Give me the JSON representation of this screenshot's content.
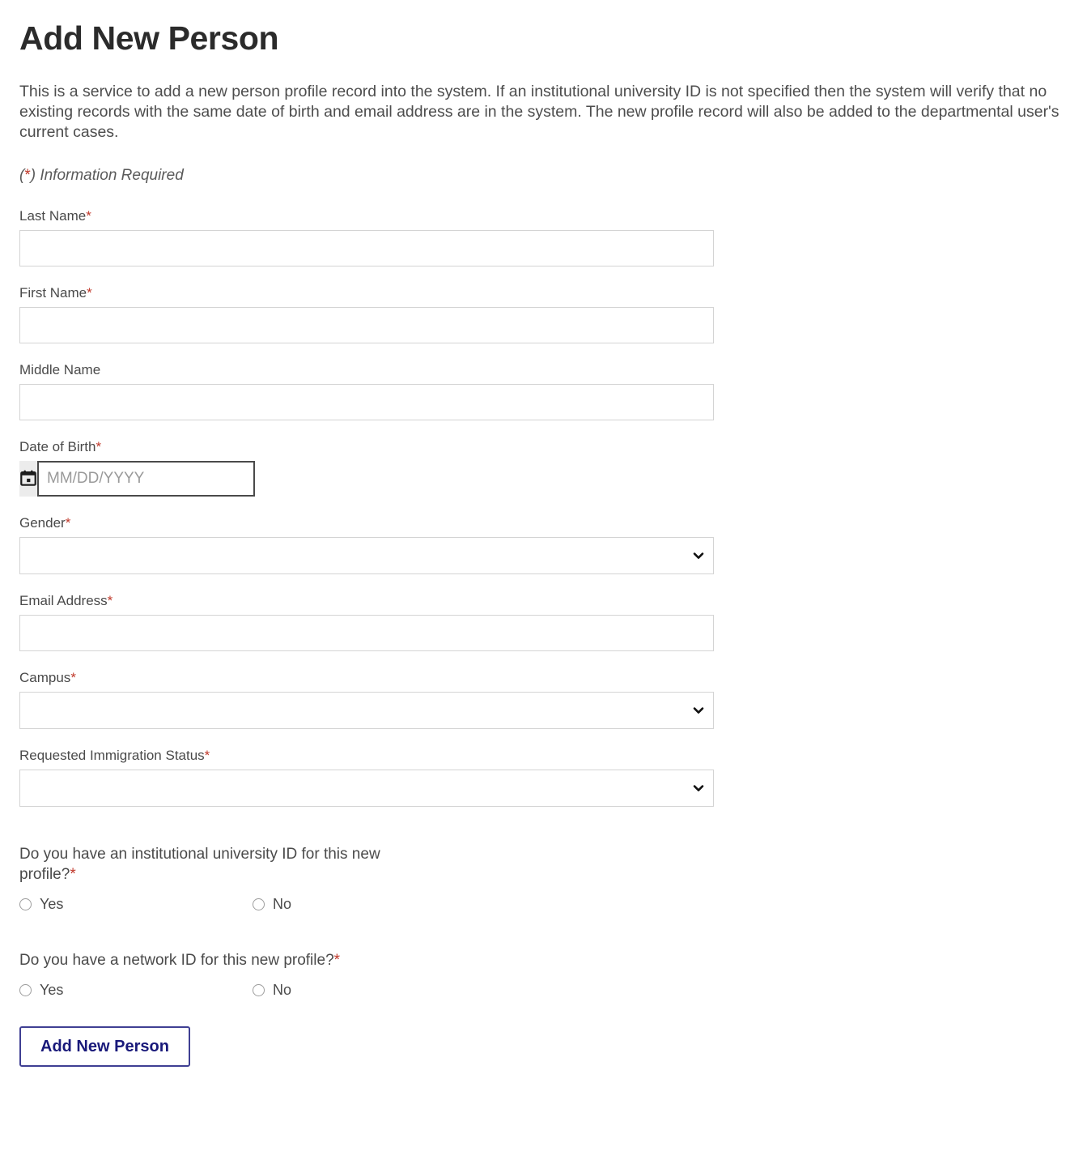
{
  "page": {
    "title": "Add New Person",
    "intro": "This is a service to add a new person profile record into the system. If an institutional university ID is not specified then the system will verify that no existing records with the same date of birth and email address are in the system. The new profile record will also be added to the departmental user's current cases.",
    "required_note_prefix": "(*)",
    "required_note_text": " Information Required",
    "required_marker": "*"
  },
  "colors": {
    "required_star": "#c0392b",
    "button_border": "#3f3f93",
    "button_text": "#19197a",
    "heading": "#2b2b2b",
    "field_border": "#d4d4d4",
    "date_border": "#4a4a4a",
    "date_button_bg": "#ececec"
  },
  "fields": {
    "last_name": {
      "label": "Last Name",
      "required": true,
      "value": "",
      "placeholder": ""
    },
    "first_name": {
      "label": "First Name",
      "required": true,
      "value": "",
      "placeholder": ""
    },
    "middle_name": {
      "label": "Middle Name",
      "required": false,
      "value": "",
      "placeholder": ""
    },
    "date_of_birth": {
      "label": "Date of Birth",
      "required": true,
      "value": "",
      "placeholder": "MM/DD/YYYY",
      "icon": "calendar-icon"
    },
    "gender": {
      "label": "Gender",
      "required": true,
      "value": "",
      "options": [
        ""
      ]
    },
    "email_address": {
      "label": "Email Address",
      "required": true,
      "value": "",
      "placeholder": ""
    },
    "campus": {
      "label": "Campus",
      "required": true,
      "value": "",
      "options": [
        ""
      ]
    },
    "requested_immigration_status": {
      "label": "Requested Immigration Status",
      "required": true,
      "value": "",
      "options": [
        ""
      ]
    }
  },
  "questions": [
    {
      "name": "institutional-university-id",
      "label": "Do you have an institutional university ID for this new profile?",
      "required": true,
      "options": [
        {
          "label": "Yes",
          "value": "yes",
          "selected": false
        },
        {
          "label": "No",
          "value": "no",
          "selected": false
        }
      ]
    },
    {
      "name": "network-id",
      "label": "Do you have a network ID for this new profile?",
      "required": true,
      "options": [
        {
          "label": "Yes",
          "value": "yes",
          "selected": false
        },
        {
          "label": "No",
          "value": "no",
          "selected": false
        }
      ]
    }
  ],
  "submit": {
    "label": "Add New Person"
  },
  "icons": {
    "chevron_down": "chevron-down-icon",
    "calendar": "calendar-icon"
  }
}
